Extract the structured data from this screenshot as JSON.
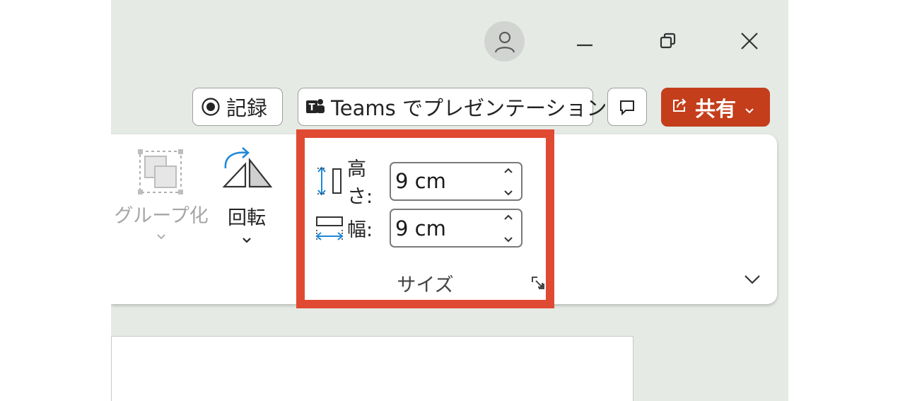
{
  "titlebar": {
    "account_icon": "person-icon",
    "minimize_icon": "minimize-icon",
    "restore_icon": "restore-icon",
    "close_icon": "close-icon"
  },
  "actions": {
    "record_label": "記録",
    "teams_label": "Teams でプレゼンテーション",
    "share_label": "共有",
    "share_color": "#c43e1c"
  },
  "ribbon": {
    "group_label": "グループ化",
    "rotate_label": "回転",
    "size_group": {
      "label": "サイズ",
      "height_label": "高さ:",
      "height_value": "9 cm",
      "width_label": "幅:",
      "width_value": "9 cm"
    }
  },
  "highlight_color": "#e04a33"
}
